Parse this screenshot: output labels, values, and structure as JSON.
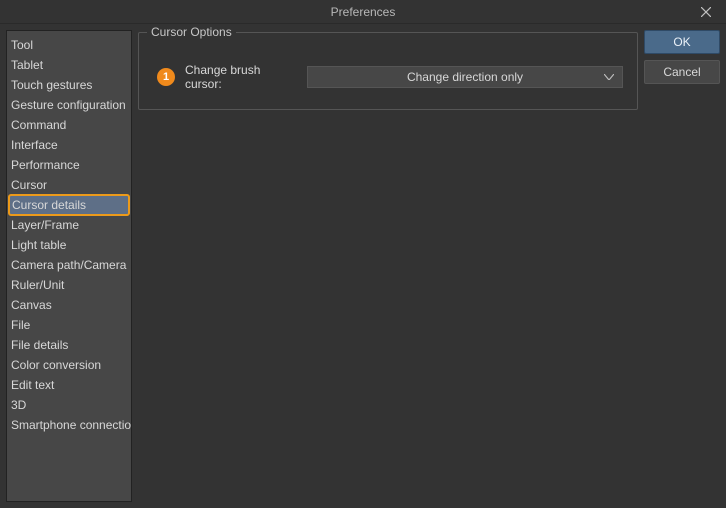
{
  "window": {
    "title": "Preferences"
  },
  "sidebar": {
    "items": [
      {
        "label": "Tool",
        "selected": false
      },
      {
        "label": "Tablet",
        "selected": false
      },
      {
        "label": "Touch gestures",
        "selected": false
      },
      {
        "label": "Gesture configuration",
        "selected": false
      },
      {
        "label": "Command",
        "selected": false
      },
      {
        "label": "Interface",
        "selected": false
      },
      {
        "label": "Performance",
        "selected": false
      },
      {
        "label": "Cursor",
        "selected": false
      },
      {
        "label": "Cursor details",
        "selected": true
      },
      {
        "label": "Layer/Frame",
        "selected": false
      },
      {
        "label": "Light table",
        "selected": false
      },
      {
        "label": "Camera path/Camera",
        "selected": false
      },
      {
        "label": "Ruler/Unit",
        "selected": false
      },
      {
        "label": "Canvas",
        "selected": false
      },
      {
        "label": "File",
        "selected": false
      },
      {
        "label": "File details",
        "selected": false
      },
      {
        "label": "Color conversion",
        "selected": false
      },
      {
        "label": "Edit text",
        "selected": false
      },
      {
        "label": "3D",
        "selected": false
      },
      {
        "label": "Smartphone connection",
        "selected": false
      }
    ]
  },
  "main": {
    "group_title": "Cursor Options",
    "badge": "1",
    "row_label": "Change brush cursor:",
    "dropdown_value": "Change direction only"
  },
  "buttons": {
    "ok": "OK",
    "cancel": "Cancel"
  }
}
